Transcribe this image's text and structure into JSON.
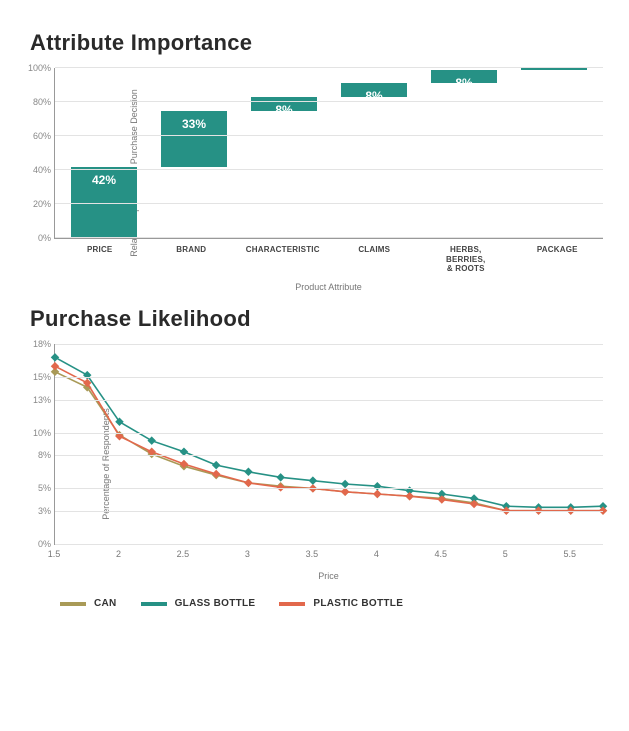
{
  "chart_data": [
    {
      "type": "bar",
      "subtype": "waterfall",
      "title": "Attribute Importance",
      "xlabel": "Product Attribute",
      "ylabel": "Relative Importance to Purchase Decision",
      "ylim": [
        0,
        100
      ],
      "y_ticks": [
        0,
        20,
        40,
        60,
        80,
        100
      ],
      "y_tick_format": "percent",
      "categories": [
        "PRICE",
        "BRAND",
        "CHARACTERISTIC",
        "CLAIMS",
        "HERBS, BERRIES, & ROOTS",
        "PACKAGE"
      ],
      "values": [
        42,
        33,
        8,
        8,
        8,
        1
      ],
      "labels": [
        "42%",
        "33%",
        "8%",
        "8%",
        "8%",
        ""
      ],
      "color": "#269185"
    },
    {
      "type": "line",
      "title": "Purchase Likelihood",
      "xlabel": "Price",
      "ylabel": "Percentage of Respondents",
      "ylim": [
        0,
        18
      ],
      "xlim": [
        1.5,
        5.75
      ],
      "y_ticks": [
        0,
        3,
        5,
        8,
        10,
        13,
        15,
        18
      ],
      "y_tick_format": "percent",
      "x_ticks": [
        1.5,
        2,
        2.5,
        3,
        3.5,
        4,
        4.5,
        5,
        5.5
      ],
      "x": [
        1.5,
        1.75,
        2.0,
        2.25,
        2.5,
        2.75,
        3.0,
        3.25,
        3.5,
        3.75,
        4.0,
        4.25,
        4.5,
        4.75,
        5.0,
        5.25,
        5.5,
        5.75
      ],
      "series": [
        {
          "name": "CAN",
          "color": "#a99a57",
          "values": [
            15.5,
            14.1,
            9.8,
            8.1,
            7.0,
            6.2,
            5.5,
            5.2,
            5.0,
            4.7,
            4.5,
            4.3,
            4.1,
            3.7,
            3.0,
            3.0,
            3.0,
            3.0
          ]
        },
        {
          "name": "GLASS BOTTLE",
          "color": "#269185",
          "values": [
            16.8,
            15.2,
            11.0,
            9.3,
            8.3,
            7.1,
            6.5,
            6.0,
            5.7,
            5.4,
            5.2,
            4.8,
            4.5,
            4.1,
            3.4,
            3.3,
            3.3,
            3.4
          ]
        },
        {
          "name": "PLASTIC BOTTLE",
          "color": "#e2684c",
          "values": [
            16.0,
            14.5,
            9.7,
            8.3,
            7.2,
            6.3,
            5.5,
            5.1,
            5.0,
            4.7,
            4.5,
            4.3,
            4.0,
            3.6,
            3.0,
            3.0,
            3.0,
            3.0
          ]
        }
      ],
      "legend": [
        "CAN",
        "GLASS BOTTLE",
        "PLASTIC BOTTLE"
      ]
    }
  ]
}
